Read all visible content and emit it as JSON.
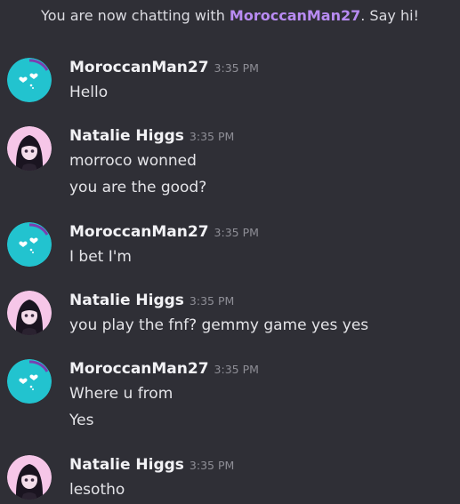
{
  "banner": {
    "prefix": "You are now chatting with ",
    "user": "MoroccanMan27",
    "suffix": ". Say hi!"
  },
  "messages": [
    {
      "author": "MoroccanMan27",
      "time": "3:35 PM",
      "avatar": "teal-hearts-avatar",
      "lines": [
        "Hello"
      ]
    },
    {
      "author": "Natalie Higgs",
      "time": "3:35 PM",
      "avatar": "anime-girl-avatar",
      "lines": [
        "morroco wonned",
        "you are the good?"
      ]
    },
    {
      "author": "MoroccanMan27",
      "time": "3:35 PM",
      "avatar": "teal-hearts-avatar",
      "lines": [
        "I bet I'm"
      ]
    },
    {
      "author": "Natalie Higgs",
      "time": "3:35 PM",
      "avatar": "anime-girl-avatar",
      "lines": [
        "you play the fnf? gemmy game yes yes"
      ]
    },
    {
      "author": "MoroccanMan27",
      "time": "3:35 PM",
      "avatar": "teal-hearts-avatar",
      "lines": [
        "Where u from",
        "Yes"
      ]
    },
    {
      "author": "Natalie Higgs",
      "time": "3:35 PM",
      "avatar": "anime-girl-avatar",
      "lines": [
        "lesotho"
      ]
    }
  ],
  "colors": {
    "background": "#2f2f36",
    "highlight": "#b88bf2",
    "teal_avatar": "#22c3cf"
  }
}
